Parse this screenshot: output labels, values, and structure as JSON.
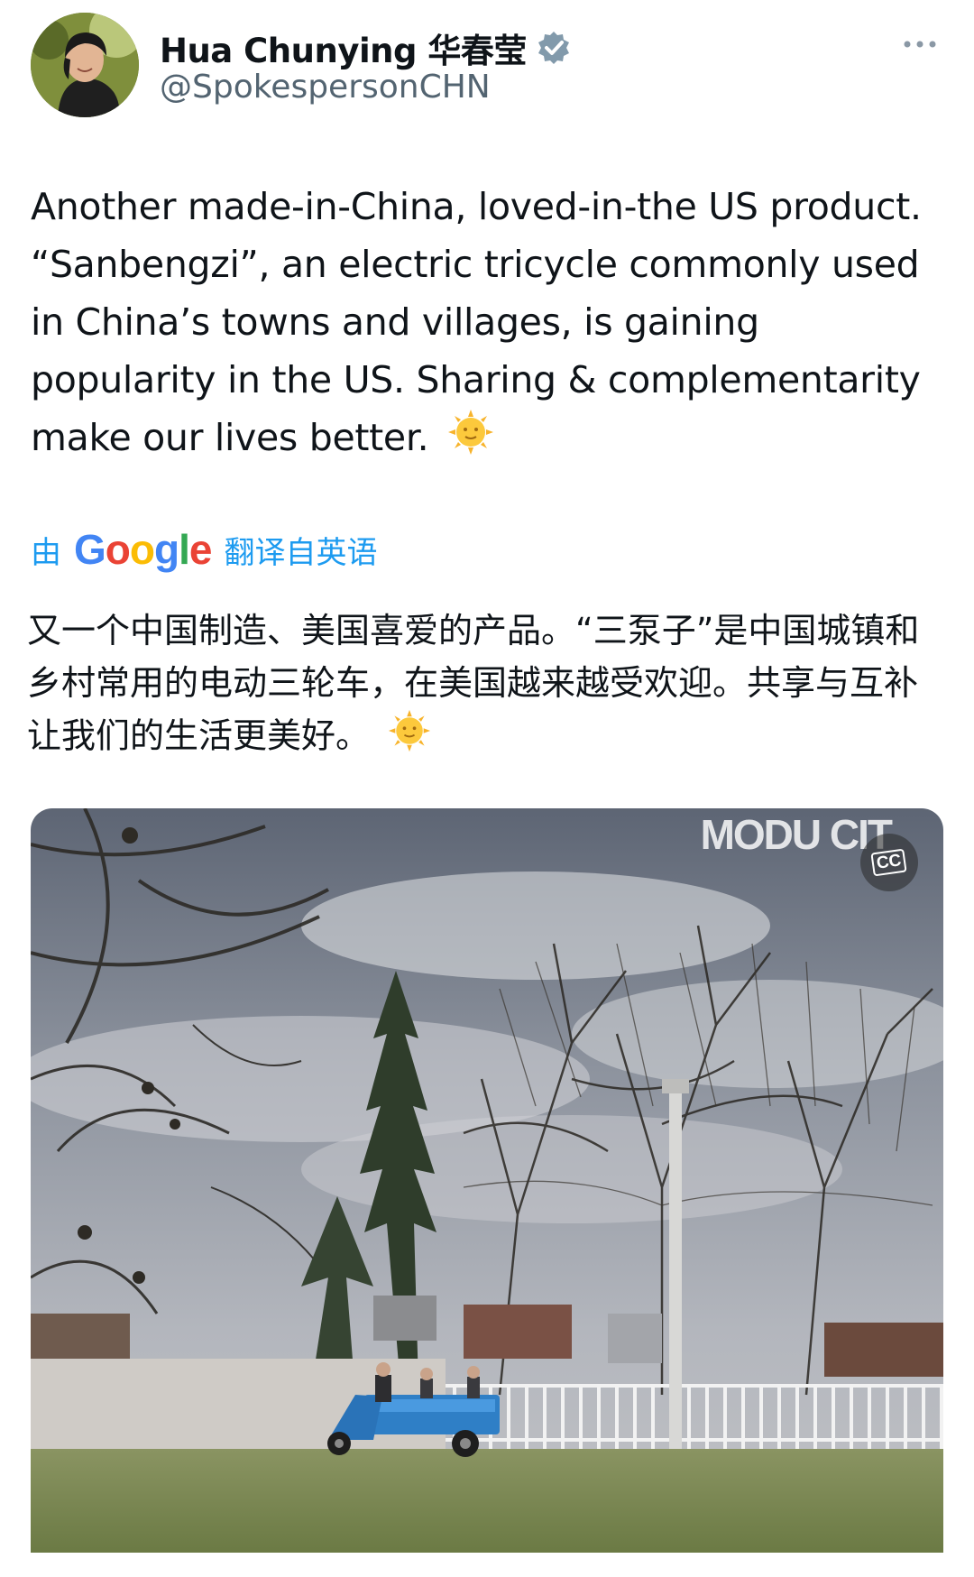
{
  "tweet": {
    "author_name": "Hua Chunying 华春莹",
    "handle": "@SpokespersonCHN",
    "text": "Another made-in-China, loved-in-the US product. “Sanbengzi”, an electric tricycle commonly used in China’s towns and villages, is gaining popularity in the US. Sharing & complementarity make our lives better.",
    "emoji": "sun-with-face"
  },
  "translation": {
    "by_label": "由",
    "provider": "Google",
    "from_label": "翻译自英语",
    "text": "又一个中国制造、美国喜爱的产品。“三泵子”是中国城镇和乡村常用的电动三轮车，在美国越来越受欢迎。共享与互补让我们的生活更美好。"
  },
  "media": {
    "watermark": "MODU CIT",
    "cc_label": "CC"
  },
  "icons": {
    "verified": "verified-badge-icon",
    "more": "more-options-icon",
    "emoji": "sun-emoji-icon",
    "captions": "captions-icon"
  },
  "colors": {
    "link": "#1d9bf0",
    "handle": "#536471",
    "verified": "#829aab"
  }
}
